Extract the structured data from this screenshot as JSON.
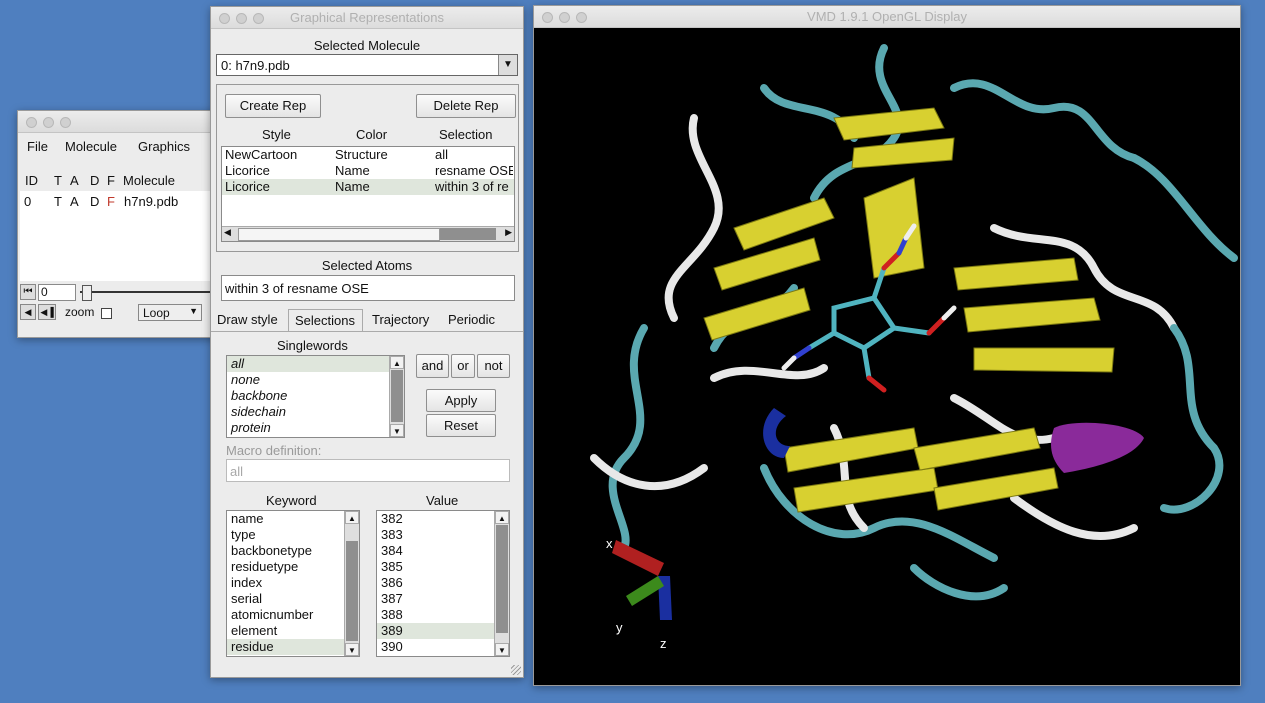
{
  "main_window": {
    "menu": [
      "File",
      "Molecule",
      "Graphics"
    ],
    "headers": [
      "ID",
      "T",
      "A",
      "D",
      "F",
      "Molecule"
    ],
    "row": {
      "id": "0",
      "t": "T",
      "a": "A",
      "d": "D",
      "f": "F",
      "molecule": "h7n9.pdb"
    },
    "frame_value": "0",
    "zoom_label": "zoom",
    "loop_value": "Loop"
  },
  "graph_rep": {
    "title": "Graphical Representations",
    "selected_molecule_label": "Selected Molecule",
    "selected_molecule": "0: h7n9.pdb",
    "create_rep": "Create Rep",
    "delete_rep": "Delete Rep",
    "columns": [
      "Style",
      "Color",
      "Selection"
    ],
    "reps": [
      {
        "style": "NewCartoon",
        "color": "Structure",
        "selection": "all"
      },
      {
        "style": "Licorice",
        "color": "Name",
        "selection": "resname OSE"
      },
      {
        "style": "Licorice",
        "color": "Name",
        "selection": "within 3 of re"
      }
    ],
    "selected_atoms_label": "Selected Atoms",
    "selected_atoms": "within 3 of resname OSE",
    "tabs": [
      "Draw style",
      "Selections",
      "Trajectory",
      "Periodic"
    ],
    "singlewords_label": "Singlewords",
    "singlewords": [
      "all",
      "none",
      "backbone",
      "sidechain",
      "protein"
    ],
    "and": "and",
    "or": "or",
    "not": "not",
    "apply": "Apply",
    "reset": "Reset",
    "macro_label": "Macro definition:",
    "macro_value": "all",
    "keyword_label": "Keyword",
    "value_label": "Value",
    "keywords": [
      "name",
      "type",
      "backbonetype",
      "residuetype",
      "index",
      "serial",
      "atomicnumber",
      "element",
      "residue"
    ],
    "values": [
      "382",
      "383",
      "384",
      "385",
      "386",
      "387",
      "388",
      "389",
      "390"
    ]
  },
  "display": {
    "title": "VMD 1.9.1 OpenGL Display",
    "axes": {
      "x": "x",
      "y": "y",
      "z": "z"
    }
  },
  "colors": {
    "desktop": "#4f7fbf",
    "helix": "#d8d030",
    "coil": "#5aa8b0",
    "turn": "#e8e8e8",
    "ligand": "#50b4c0"
  }
}
